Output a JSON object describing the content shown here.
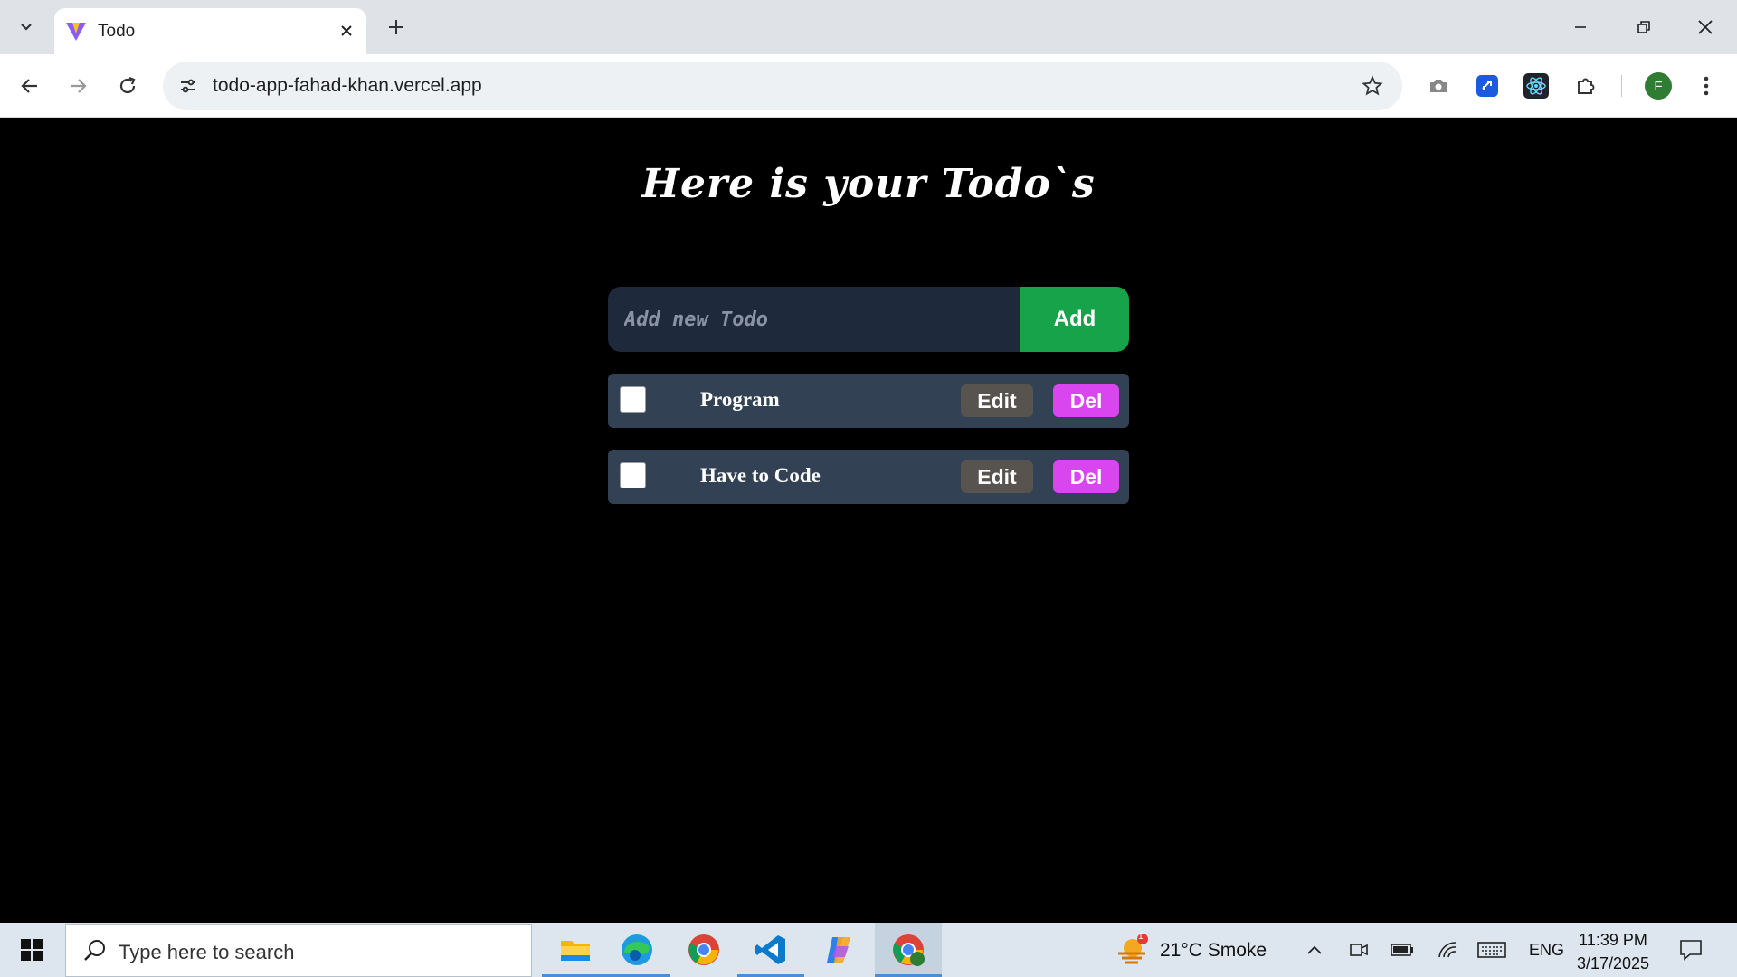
{
  "browser": {
    "tab_title": "Todo",
    "url": "todo-app-fahad-khan.vercel.app",
    "profile_initial": "F"
  },
  "page": {
    "title": "Here is your Todo`s",
    "input_placeholder": "Add new Todo",
    "add_label": "Add",
    "todos": [
      {
        "text": "Program",
        "checked": false,
        "edit_label": "Edit",
        "delete_label": "Del"
      },
      {
        "text": "Have to Code",
        "checked": false,
        "edit_label": "Edit",
        "delete_label": "Del"
      }
    ]
  },
  "taskbar": {
    "search_placeholder": "Type here to search",
    "weather": "21°C  Smoke",
    "weather_badge": "1",
    "language": "ENG",
    "time": "11:39 PM",
    "date": "3/17/2025"
  },
  "colors": {
    "add_button": "#16a34a",
    "delete_button": "#d946ef",
    "edit_button": "#57534e",
    "todo_bg": "#334155",
    "input_bg": "#1e293b"
  }
}
